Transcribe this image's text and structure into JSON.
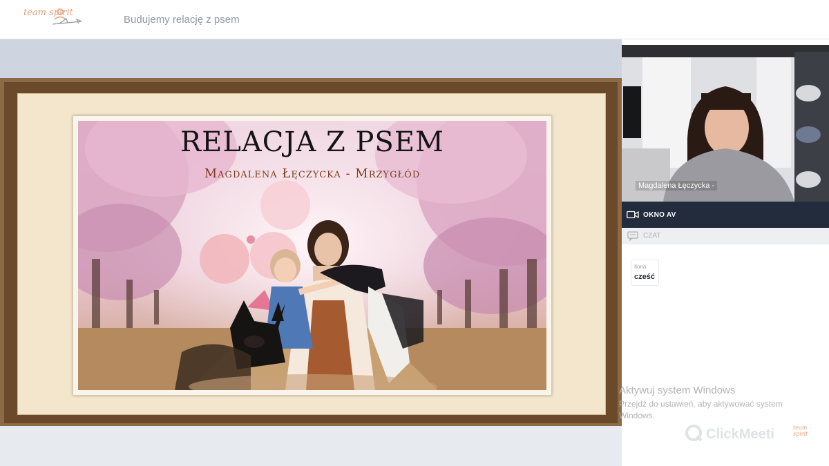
{
  "header": {
    "logo_text": "team spirit",
    "meeting_title": "Budujemy relację z psem"
  },
  "slide": {
    "title": "RELACJA Z PSEM",
    "subtitle": "Magdalena Łęczycka - Mrzygłód"
  },
  "video": {
    "participant_name": "Magdalena Łęczycka -"
  },
  "panels": {
    "av_label": "OKNO AV",
    "chat_label": "CZAT"
  },
  "chat": {
    "messages": [
      {
        "author": "Ilona",
        "text": "cześć"
      }
    ]
  },
  "watermarks": {
    "windows_line1": "Aktywuj system Windows",
    "windows_line2": "Przejdź do ustawień, aby aktywować system",
    "windows_line3": "Windows.",
    "clickmeeting": "ClickMeeti",
    "logo_text": "team spirit"
  },
  "colors": {
    "accent_dark_bar": "#232c3c",
    "brand_orange": "#e6a17a",
    "stage_bg": "#ced5e0"
  }
}
